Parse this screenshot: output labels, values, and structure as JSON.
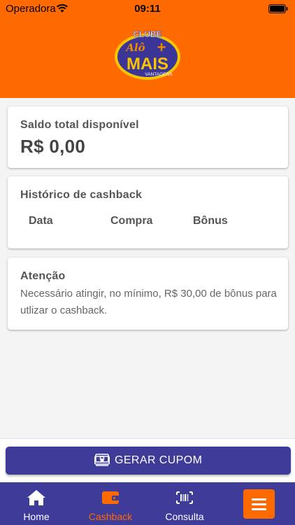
{
  "status_bar": {
    "carrier": "Operadora",
    "time": "09:11"
  },
  "logo": {
    "top": "CLUBE",
    "script": "Alô",
    "main": "MAIS",
    "sub": "VANTAGENS"
  },
  "balance_card": {
    "title": "Saldo total disponível",
    "value": "R$ 0,00"
  },
  "history_card": {
    "title": "Histórico de cashback",
    "columns": [
      "Data",
      "Compra",
      "Bônus"
    ]
  },
  "attention_card": {
    "title": "Atenção",
    "text": "Necessário atingir, no mínimo, R$ 30,00 de bônus para utlizar o cashback."
  },
  "cta": {
    "label": "GERAR CUPOM",
    "icon": "money-icon"
  },
  "tabs": [
    {
      "label": "Home",
      "icon": "home-icon",
      "active": false
    },
    {
      "label": "Cashback",
      "icon": "wallet-icon",
      "active": true
    },
    {
      "label": "Consulta",
      "icon": "barcode-icon",
      "active": false
    }
  ],
  "menu_button": {
    "icon": "hamburger-menu-icon"
  },
  "colors": {
    "brand_orange": "#ff6a00",
    "brand_indigo": "#3f3b98",
    "background": "#f4f4f4"
  }
}
